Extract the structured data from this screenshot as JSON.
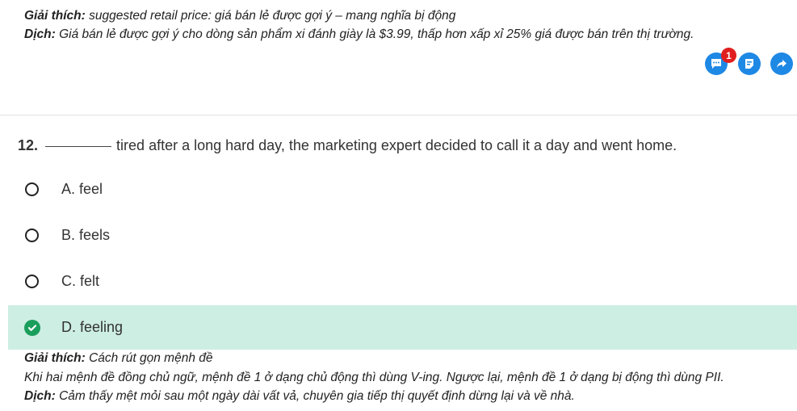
{
  "prev_explanation": {
    "giai_thich_label": "Giải thích:",
    "giai_thich_text": "suggested retail price: giá bán lẻ được gợi ý – mang nghĩa bị động",
    "dich_label": "Dịch:",
    "dich_text": "Giá bán lẻ được gợi ý cho dòng sản phẩm xi đánh giày là $3.99, thấp hơn xấp xỉ 25% giá được bán trên thị trường."
  },
  "action_icons": [
    {
      "name": "comment-icon",
      "badge": "1"
    },
    {
      "name": "note-icon"
    },
    {
      "name": "share-icon"
    }
  ],
  "question": {
    "number": "12.",
    "text": "tired after a long hard day, the marketing expert decided to call it a day and went home."
  },
  "options": [
    {
      "label": "A. feel",
      "selected": false
    },
    {
      "label": "B. feels",
      "selected": false
    },
    {
      "label": "C. felt",
      "selected": false
    },
    {
      "label": "D. feeling",
      "selected": true
    }
  ],
  "explanation": {
    "giai_thich_label": "Giải thích:",
    "giai_thich_text": "Cách rút gọn mệnh đề",
    "detail": "Khi hai mệnh đề đồng chủ ngữ, mệnh đề 1 ở dạng chủ động thì dùng V-ing. Ngược lại, mệnh đề 1 ở dạng bị động thì dùng PII.",
    "dich_label": "Dịch:",
    "dich_text": "Cảm thấy mệt mỏi sau một ngày dài vất vả, chuyên gia tiếp thị quyết định dừng lại và về nhà."
  },
  "colors": {
    "accent": "#1e88e5",
    "badge": "#e01e1e",
    "correct_bg": "#cdeee3",
    "check": "#1a9e5c"
  }
}
